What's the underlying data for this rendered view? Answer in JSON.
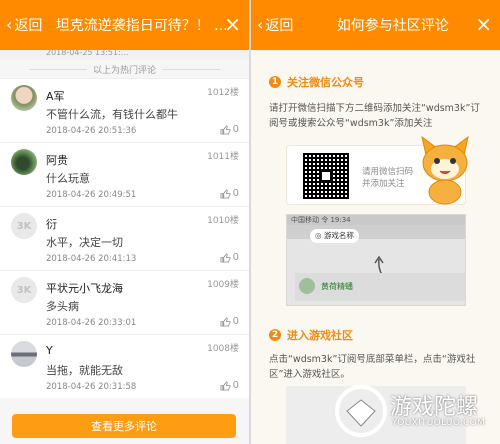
{
  "left": {
    "header": {
      "back_label": "返回",
      "title": "坦克流逆袭指日可待？！ ...",
      "close_icon": "×"
    },
    "ticker_text": "2018-04-25 13:51:...",
    "section_label": "以上为热门评论",
    "comments": [
      {
        "name": "A军",
        "floor": "1012楼",
        "text": "不管什么流，有钱什么都牛",
        "time": "2018-04-26 20:51:36",
        "likes": "0"
      },
      {
        "name": "阿贵",
        "floor": "1011楼",
        "text": "什么玩意",
        "time": "2018-04-26 20:49:51",
        "likes": "0"
      },
      {
        "name": "衍",
        "floor": "1010楼",
        "text": "水平，决定一切",
        "time": "2018-04-26 20:41:13",
        "likes": "0"
      },
      {
        "name": "平状元小飞龙海",
        "floor": "1009楼",
        "text": "多头病",
        "time": "2018-04-26 20:33:01",
        "likes": "0"
      },
      {
        "name": "Y",
        "floor": "1008楼",
        "text": "当拖，就能无敌",
        "time": "2018-04-26 20:31:58",
        "likes": "0"
      }
    ],
    "more_button": "查看更多评论"
  },
  "right": {
    "header": {
      "back_label": "返回",
      "title": "如何参与社区评论",
      "close_icon": "×"
    },
    "step1": {
      "num": "1",
      "title": "关注微信公众号",
      "desc": "请打开微信扫描下方二维码添加关注“wdsm3k”订阅号或搜索公众号“wdsm3k”添加关注"
    },
    "qr_hint": "请用微信扫码\n并添加关注",
    "shot": {
      "status": "中国移动  令      19:34",
      "bubble": "游戏名称",
      "row_text": "黄荷精蟠"
    },
    "step2": {
      "num": "2",
      "title": "进入游戏社区",
      "desc": "点击“wdsm3k”订阅号底部菜单栏，点击“游戏社区”进入游戏社区。"
    },
    "watermark": {
      "title": "游戏陀螺",
      "url": "YOUXITUOLUO.COM"
    }
  }
}
